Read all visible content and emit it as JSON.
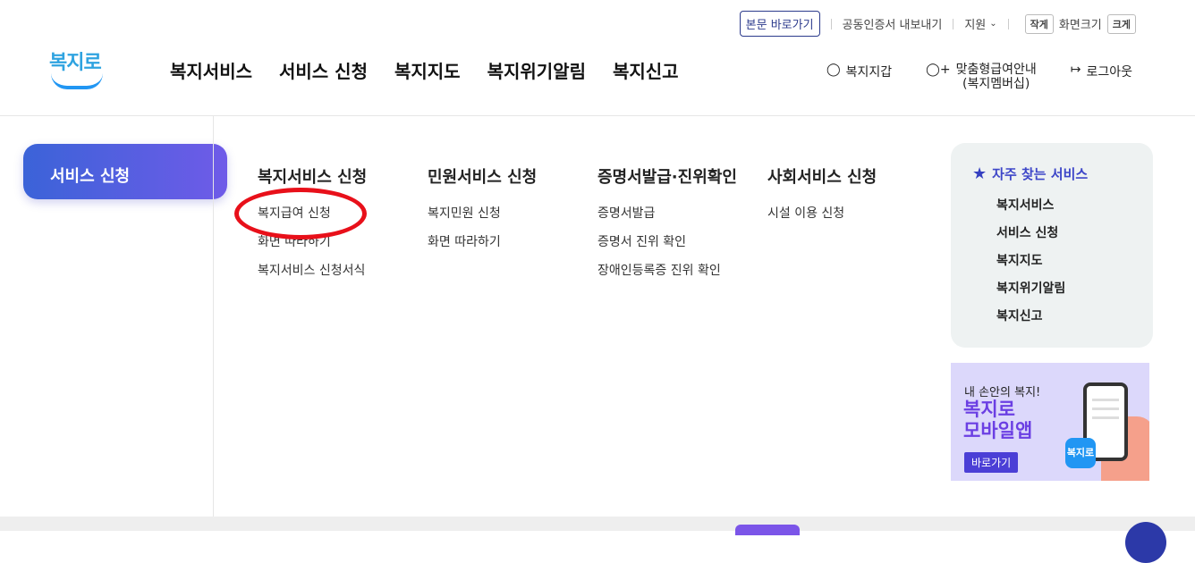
{
  "header": {
    "logo_text": "복지로",
    "util": {
      "skip_link": "본문 바로가기",
      "cert_export": "공동인증서 내보내기",
      "support": "지원",
      "font_small": "작게",
      "font_label": "화면크기",
      "font_large": "크게"
    },
    "gnb": [
      "복지서비스",
      "서비스 신청",
      "복지지도",
      "복지위기알림",
      "복지신고"
    ],
    "user_nav": {
      "wallet": "복지지갑",
      "membership_line1": "맞춤형급여안내",
      "membership_line2": "(복지멤버십)",
      "logout": "로그아웃"
    }
  },
  "left_tab": "서비스 신청",
  "menu": {
    "col1": {
      "title": "복지서비스 신청",
      "items": [
        "복지급여 신청",
        "화면 따라하기",
        "복지서비스 신청서식"
      ]
    },
    "col2": {
      "title": "민원서비스 신청",
      "items": [
        "복지민원 신청",
        "화면 따라하기"
      ]
    },
    "col3": {
      "title": "증명서발급·진위확인",
      "items": [
        "증명서발급",
        "증명서 진위 확인",
        "장애인등록증 진위 확인"
      ]
    },
    "col4": {
      "title": "사회서비스 신청",
      "items": [
        "시설 이용 신청"
      ]
    }
  },
  "favorites": {
    "title": "자주 찾는 서비스",
    "items": [
      "복지서비스",
      "서비스 신청",
      "복지지도",
      "복지위기알림",
      "복지신고"
    ]
  },
  "banner": {
    "line1": "내 손안의 복지!",
    "line2": "복지로",
    "line3": "모바일앱",
    "button": "바로가기",
    "app_logo": "복지로"
  },
  "colors": {
    "accent_blue": "#3b63d8",
    "accent_purple": "#6f5be8",
    "annotation_red": "#e8101a"
  },
  "icons": [
    "user-icon",
    "user-plus-icon",
    "logout-icon",
    "star-icon",
    "chevron-down-icon"
  ]
}
